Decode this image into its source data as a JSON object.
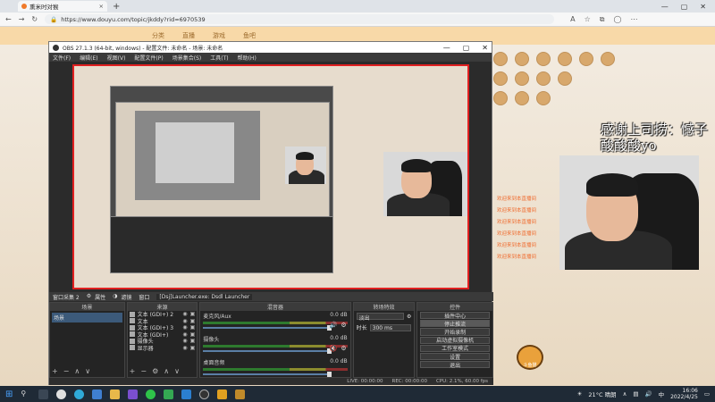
{
  "browser": {
    "tab_title": "熏米时对猴",
    "tab_close": "×",
    "new_tab": "+",
    "url": "https://www.douyu.com/topic/jkddy?rid=6970539",
    "window_controls": [
      "—",
      "▢",
      "✕"
    ]
  },
  "douyu": {
    "nav_items": [
      "分类",
      "直播",
      "游戏",
      "鱼吧"
    ],
    "overlay_text": "感谢上司捞：憾子酸酸酸yo",
    "chat_lines": [
      {
        "user": "欢迎来到本直播间",
        "text": ""
      },
      {
        "user": "欢迎来到本直播间",
        "text": ""
      },
      {
        "user": "欢迎来到本直播间",
        "text": ""
      },
      {
        "user": "欢迎来到本直播间",
        "text": ""
      },
      {
        "user": "欢迎来到本直播间",
        "text": ""
      },
      {
        "user": "欢迎来到本直播间",
        "text": ""
      }
    ],
    "mascot_label": "斗鱼猫"
  },
  "obs": {
    "title": "OBS 27.1.3 (64-bit, windows) - 配置文件: 未命名 - 场景: 未命名",
    "menu": [
      "文件(F)",
      "编辑(E)",
      "视图(V)",
      "配置文件(P)",
      "场景集合(S)",
      "工具(T)",
      "帮助(H)"
    ],
    "bar": {
      "window_label": "窗口采集 2",
      "properties": "属性",
      "filters": "滤镜",
      "window_text": "窗口",
      "window_value": "[Dsj]Launcher.exe: Dsdl Launcher"
    },
    "docks": {
      "scenes": {
        "title": "场景",
        "items": [
          "场景"
        ]
      },
      "sources": {
        "title": "来源",
        "items": [
          "文本 (GDI+) 2",
          "文本",
          "文本 (GDI+) 3",
          "文本 (GDI+)",
          "摄像头",
          "显示器"
        ]
      },
      "mixer": {
        "title": "混音器",
        "channels": [
          {
            "name": "麦克风/Aux",
            "db": "0.0 dB"
          },
          {
            "name": "摄像头",
            "db": "0.0 dB"
          },
          {
            "name": "桌面音频",
            "db": "0.0 dB"
          }
        ]
      },
      "transitions": {
        "title": "转场特效",
        "type": "淡出",
        "duration_label": "时长",
        "duration_value": "300 ms"
      },
      "controls": {
        "title": "控件",
        "buttons": [
          "停止推流",
          "开始录制",
          "启动虚拟摄像机",
          "工作室模式",
          "设置",
          "退出"
        ],
        "top_label": "插件中心"
      }
    },
    "status": {
      "live": "LIVE: 00:00:00",
      "rec": "REC: 00:00:00",
      "cpu": "CPU: 2.1%, 60.00 fps"
    }
  },
  "taskbar": {
    "weather": "21°C 晴朗",
    "time": "16:06",
    "date": "2022/4/25"
  }
}
